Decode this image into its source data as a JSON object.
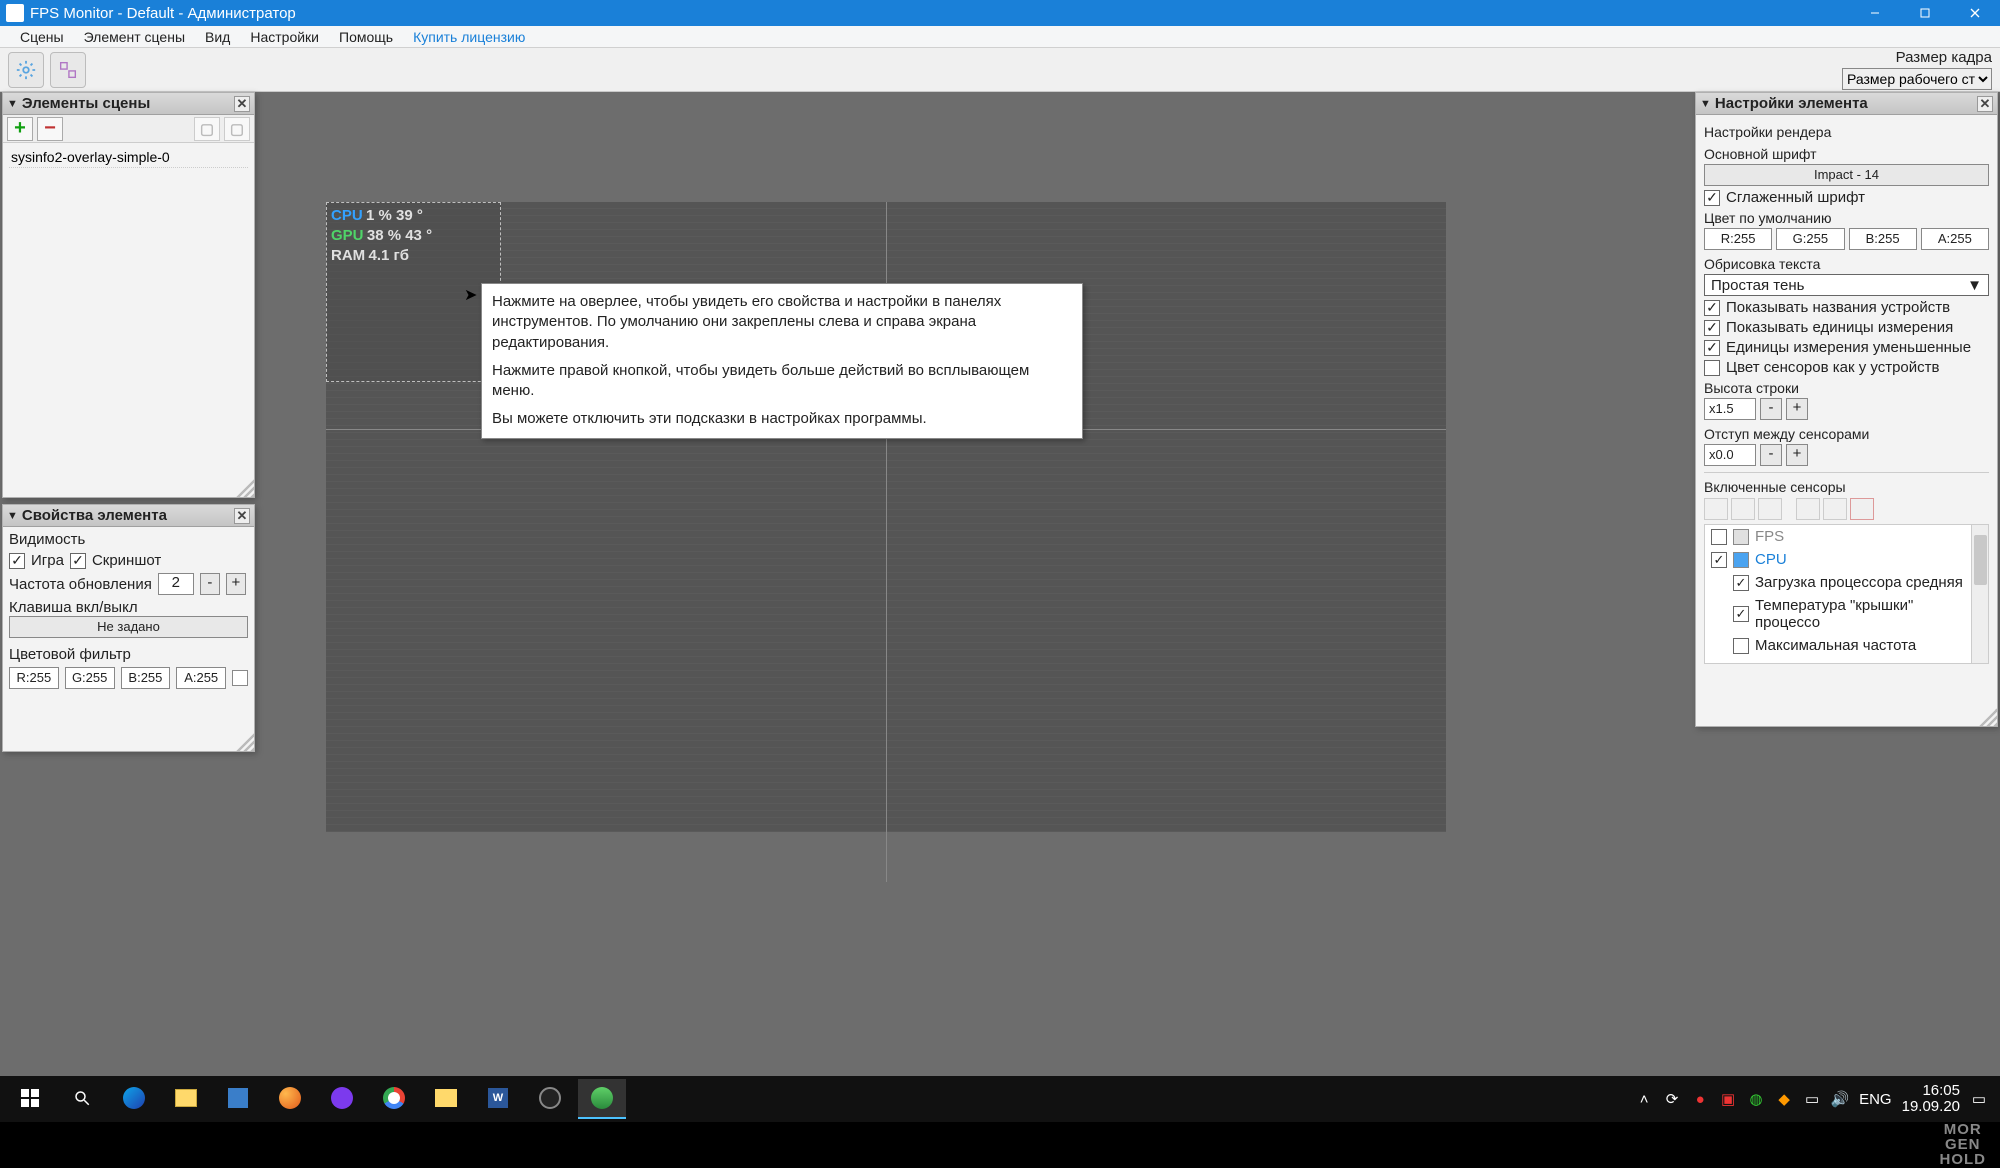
{
  "titlebar": {
    "title": "FPS Monitor - Default - Администратор"
  },
  "menu": {
    "scenes": "Сцены",
    "scene_element": "Элемент сцены",
    "view": "Вид",
    "settings": "Настройки",
    "help": "Помощь",
    "buy": "Купить лицензию"
  },
  "toolbar": {
    "frame_size_label": "Размер кадра",
    "frame_size_value": "Размер рабочего ст"
  },
  "elements_panel": {
    "title": "Элементы сцены",
    "item0": "sysinfo2-overlay-simple-0"
  },
  "props_panel": {
    "title": "Свойства элемента",
    "visibility": "Видимость",
    "game": "Игра",
    "screenshot": "Скриншот",
    "update_freq": "Частота обновления",
    "update_val": "2",
    "toggle_key": "Клавиша вкл/выкл",
    "not_set": "Не задано",
    "color_filter": "Цветовой фильтр",
    "r": "R:255",
    "g": "G:255",
    "b": "B:255",
    "a": "A:255"
  },
  "right_panel": {
    "title": "Настройки элемента",
    "render_settings": "Настройки рендера",
    "main_font": "Основной шрифт",
    "font_btn": "Impact - 14",
    "antialias": "Сглаженный шрифт",
    "default_color": "Цвет по умолчанию",
    "r": "R:255",
    "g": "G:255",
    "b": "B:255",
    "a": "A:255",
    "text_stroke": "Обрисовка текста",
    "stroke_value": "Простая тень",
    "show_device_names": "Показывать названия устройств",
    "show_units": "Показывать единицы измерения",
    "units_small": "Единицы измерения уменьшенные",
    "sensor_colors_as_device": "Цвет сенсоров как у устройств",
    "line_height": "Высота строки",
    "line_height_val": "x1.5",
    "sensor_spacing": "Отступ между сенсорами",
    "sensor_spacing_val": "x0.0",
    "enabled_sensors": "Включенные сенсоры",
    "fps": "FPS",
    "cpu": "CPU",
    "cpu_load": "Загрузка процессора средняя",
    "cpu_temp": "Температура \"крышки\" процессо",
    "cpu_maxfreq": "Максимальная частота"
  },
  "overlay": {
    "cpu_label": "CPU",
    "cpu_vals": "1 % 39 °",
    "gpu_label": "GPU",
    "gpu_vals": "38 % 43 °",
    "ram_label": "RAM",
    "ram_vals": "4.1 гб"
  },
  "tooltip": {
    "line1": "Нажмите на оверлее, чтобы увидеть его свойства и настройки в панелях инструментов. По умолчанию они закреплены слева и справа экрана редактирования.",
    "line2": "Нажмите правой кнопкой, чтобы увидеть больше действий во всплывающем меню.",
    "line3": "Вы можете отключить эти подсказки в настройках программы."
  },
  "taskbar": {
    "lang": "ENG",
    "time": "16:05",
    "date": "19.09.20"
  },
  "bottombar": {
    "logo1": "MOR",
    "logo2": "GEN",
    "logo3": "HOLD"
  }
}
